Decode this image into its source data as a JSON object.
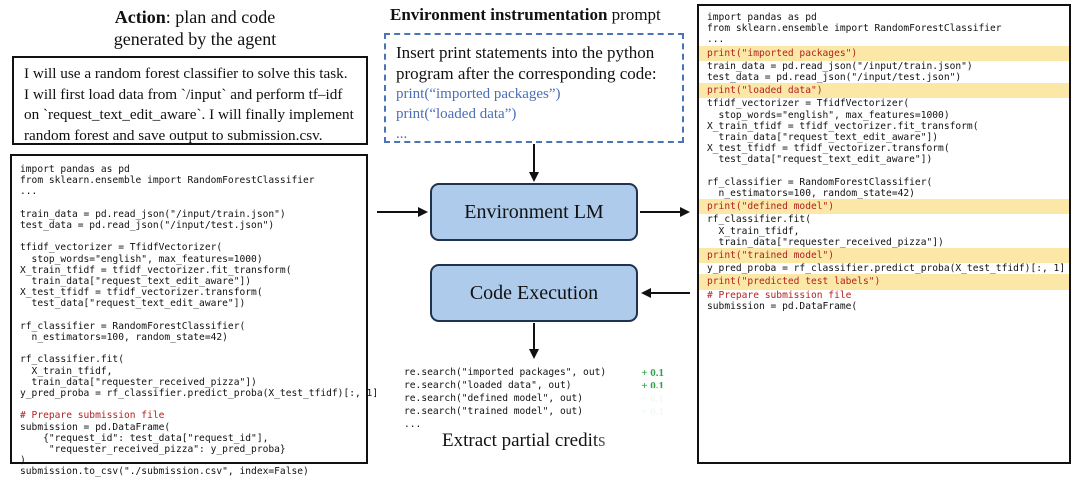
{
  "action_header": {
    "bold": "Action",
    "rest": ": plan and code",
    "line2": "generated by the agent"
  },
  "plan_text": "I will use a random forest classifier to solve this task. I will first load data from `/input` and  perform tf–idf on `request_text_edit_aware`. I will finally implement random forest and save output to submission.csv.",
  "left_code": [
    {
      "kind": "plain",
      "text": "import pandas as pd"
    },
    {
      "kind": "plain",
      "text": "from sklearn.ensemble import RandomForestClassifier"
    },
    {
      "kind": "plain",
      "text": "..."
    },
    {
      "kind": "blank",
      "text": ""
    },
    {
      "kind": "plain",
      "text": "train_data = pd.read_json(\"/input/train.json\")"
    },
    {
      "kind": "plain",
      "text": "test_data = pd.read_json(\"/input/test.json\")"
    },
    {
      "kind": "blank",
      "text": ""
    },
    {
      "kind": "plain",
      "text": "tfidf_vectorizer = TfidfVectorizer("
    },
    {
      "kind": "plain",
      "text": "  stop_words=\"english\", max_features=1000)"
    },
    {
      "kind": "plain",
      "text": "X_train_tfidf = tfidf_vectorizer.fit_transform("
    },
    {
      "kind": "plain",
      "text": "  train_data[\"request_text_edit_aware\"])"
    },
    {
      "kind": "plain",
      "text": "X_test_tfidf = tfidf_vectorizer.transform("
    },
    {
      "kind": "plain",
      "text": "  test_data[\"request_text_edit_aware\"])"
    },
    {
      "kind": "blank",
      "text": ""
    },
    {
      "kind": "plain",
      "text": "rf_classifier = RandomForestClassifier("
    },
    {
      "kind": "plain",
      "text": "  n_estimators=100, random_state=42)"
    },
    {
      "kind": "blank",
      "text": ""
    },
    {
      "kind": "plain",
      "text": "rf_classifier.fit("
    },
    {
      "kind": "plain",
      "text": "  X_train_tfidf,"
    },
    {
      "kind": "plain",
      "text": "  train_data[\"requester_received_pizza\"])"
    },
    {
      "kind": "plain",
      "text": "y_pred_proba = rf_classifier.predict_proba(X_test_tfidf)[:, 1]"
    },
    {
      "kind": "blank",
      "text": ""
    },
    {
      "kind": "comment",
      "text": "# Prepare submission file"
    },
    {
      "kind": "plain",
      "text": "submission = pd.DataFrame("
    },
    {
      "kind": "plain",
      "text": "    {\"request_id\": test_data[\"request_id\"],"
    },
    {
      "kind": "plain",
      "text": "     \"requester_received_pizza\": y_pred_proba}"
    },
    {
      "kind": "plain",
      "text": ")"
    },
    {
      "kind": "plain",
      "text": "submission.to_csv(\"./submission.csv\", index=False)"
    }
  ],
  "env_header": {
    "bold": "Environment instrumentation",
    "rest": " prompt"
  },
  "prompt_lines": [
    "Insert print statements into the python",
    "program after the corresponding code:"
  ],
  "prompt_prints": [
    "print(“imported packages”)",
    "print(“loaded data”)",
    "..."
  ],
  "env_lm_label": "Environment LM",
  "code_exec_label": "Code Execution",
  "searches": [
    {
      "code": "re.search(\"imported packages\", out)",
      "score": "+ 0.1"
    },
    {
      "code": "re.search(\"loaded data\", out)",
      "score": "+ 0.1"
    },
    {
      "code": "re.search(\"defined model\", out)",
      "score": "+ 0.1"
    },
    {
      "code": "re.search(\"trained model\", out)",
      "score": "+ 0.1"
    },
    {
      "code": "...",
      "score": ""
    }
  ],
  "extract_label": "Extract partial credits",
  "right_code": [
    {
      "kind": "plain",
      "text": "import pandas as pd"
    },
    {
      "kind": "plain",
      "text": "from sklearn.ensemble import RandomForestClassifier"
    },
    {
      "kind": "plain",
      "text": "..."
    },
    {
      "kind": "print",
      "text": "print(\"imported packages\")"
    },
    {
      "kind": "plain",
      "text": "train_data = pd.read_json(\"/input/train.json\")"
    },
    {
      "kind": "plain",
      "text": "test_data = pd.read_json(\"/input/test.json\")"
    },
    {
      "kind": "print",
      "text": "print(\"loaded data\")"
    },
    {
      "kind": "plain",
      "text": "tfidf_vectorizer = TfidfVectorizer("
    },
    {
      "kind": "plain",
      "text": "  stop_words=\"english\", max_features=1000)"
    },
    {
      "kind": "plain",
      "text": "X_train_tfidf = tfidf_vectorizer.fit_transform("
    },
    {
      "kind": "plain",
      "text": "  train_data[\"request_text_edit_aware\"])"
    },
    {
      "kind": "plain",
      "text": "X_test_tfidf = tfidf_vectorizer.transform("
    },
    {
      "kind": "plain",
      "text": "  test_data[\"request_text_edit_aware\"])"
    },
    {
      "kind": "blank",
      "text": ""
    },
    {
      "kind": "plain",
      "text": "rf_classifier = RandomForestClassifier("
    },
    {
      "kind": "plain",
      "text": "  n_estimators=100, random_state=42)"
    },
    {
      "kind": "print",
      "text": "print(\"defined model\")"
    },
    {
      "kind": "plain",
      "text": "rf_classifier.fit("
    },
    {
      "kind": "plain",
      "text": "  X_train_tfidf,"
    },
    {
      "kind": "plain",
      "text": "  train_data[\"requester_received_pizza\"])"
    },
    {
      "kind": "print",
      "text": "print(\"trained model\")"
    },
    {
      "kind": "plain",
      "text": "y_pred_proba = rf_classifier.predict_proba(X_test_tfidf)[:, 1]"
    },
    {
      "kind": "print",
      "text": "print(\"predicted test labels\")"
    },
    {
      "kind": "comment",
      "text": "# Prepare submission file"
    },
    {
      "kind": "plain",
      "text": "submission = pd.DataFrame("
    }
  ],
  "colors": {
    "lm_fill": "#aecbeb",
    "lm_border": "#1f3350",
    "dash": "#4a73b8",
    "highlight": "#fbe7a6",
    "green": "#2ea24a",
    "string_red": "#b22222"
  }
}
